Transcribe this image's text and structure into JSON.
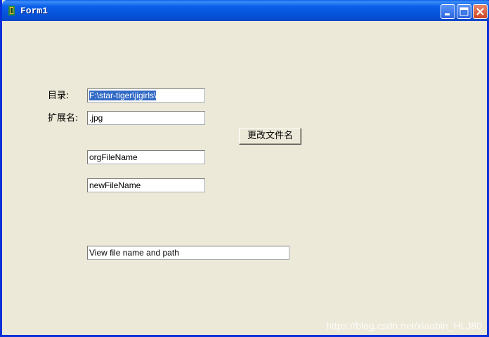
{
  "window": {
    "title": "Form1",
    "icon": "app-icon"
  },
  "titlebar_buttons": {
    "minimize": "minimize-icon",
    "maximize": "maximize-icon",
    "close": "close-icon"
  },
  "form": {
    "dir_label": "目录:",
    "dir_value": "F:\\star-tiger\\jigirls\\",
    "ext_label": "扩展名:",
    "ext_value": ".jpg",
    "rename_button": "更改文件名",
    "org_file": "orgFileName",
    "new_file": "newFileName",
    "view_path": "View file name and path"
  },
  "watermark": "https://blog.csdn.net/xiaobin_HLJ80"
}
